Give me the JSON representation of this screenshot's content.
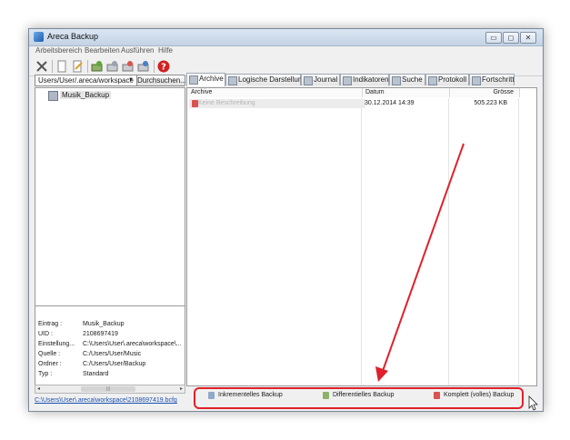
{
  "window": {
    "title": "Areca Backup",
    "btn_min": "▭",
    "btn_max": "◻",
    "btn_close": "✕"
  },
  "menu": [
    "Arbeitsbereich",
    "Bearbeiten",
    "Ausführen",
    "Hilfe"
  ],
  "workspace": {
    "path": "Users/User/.areca/workspace",
    "browse_label": "Durchsuchen..."
  },
  "tree": {
    "items": [
      {
        "label": "Musik_Backup"
      }
    ]
  },
  "info": {
    "rows": [
      {
        "key": "Eintrag :",
        "value": "Musik_Backup"
      },
      {
        "key": "UID :",
        "value": "2108697419"
      },
      {
        "key": "Einstellung...",
        "value": "C:\\Users\\User\\.areca\\workspace\\..."
      },
      {
        "key": "Quelle :",
        "value": "C:/Users/User/Music"
      },
      {
        "key": "Ordner :",
        "value": "C:/Users/User/Backup"
      },
      {
        "key": "Typ :",
        "value": "Standard"
      }
    ]
  },
  "config_link": "C:\\Users\\User\\.areca\\workspace\\2108697419.bcfg",
  "tabs": [
    {
      "label": "Archive",
      "active": true
    },
    {
      "label": "Logische Darstellung",
      "active": false
    },
    {
      "label": "Journal",
      "active": false
    },
    {
      "label": "Indikatoren",
      "active": false
    },
    {
      "label": "Suche",
      "active": false
    },
    {
      "label": "Protokoll",
      "active": false
    },
    {
      "label": "Fortschritt",
      "active": false
    }
  ],
  "table": {
    "headers": [
      "Archive",
      "Datum",
      "Grösse"
    ],
    "rows": [
      {
        "archive": "Keine Beschreibung",
        "datum": "30.12.2014 14:39",
        "groesse": "505.223 KB"
      }
    ]
  },
  "actions": {
    "incremental": "Inkrementelles Backup",
    "differential": "Differentielles Backup",
    "full": "Komplett (volles) Backup"
  },
  "colors": {
    "annotation": "#e0202a",
    "link": "#1a4fb0"
  },
  "icons": [
    "app-icon",
    "tools-icon",
    "new-doc-icon",
    "edit-icon",
    "backup-green-icon",
    "merge-icon",
    "delete-icon",
    "recover-icon",
    "help-icon",
    "database-icon",
    "cursor-icon"
  ]
}
